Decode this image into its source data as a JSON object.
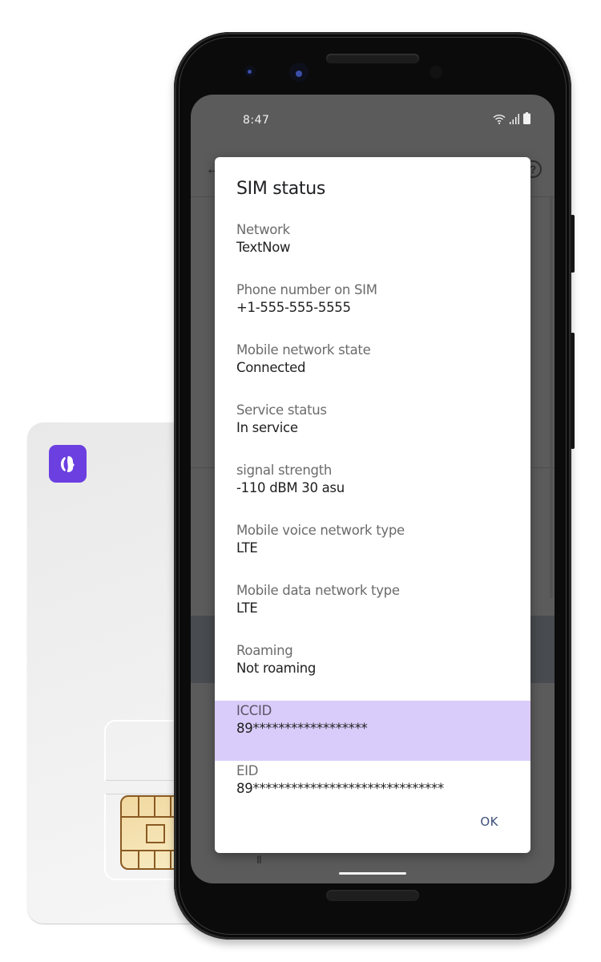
{
  "status_bar": {
    "time": "8:47",
    "icons": [
      "wifi-icon",
      "signal-icon",
      "battery-icon"
    ]
  },
  "background_screen": {
    "back_icon": "←",
    "help_icon": "?",
    "nav_pause_glyph": "II"
  },
  "dialog": {
    "title": "SIM status",
    "rows": [
      {
        "label": "Network",
        "value": "TextNow",
        "highlighted": false
      },
      {
        "label": "Phone number on SIM",
        "value": "+1-555-555-5555",
        "highlighted": false
      },
      {
        "label": "Mobile network state",
        "value": "Connected",
        "highlighted": false
      },
      {
        "label": "Service status",
        "value": "In service",
        "highlighted": false
      },
      {
        "label": "signal strength",
        "value": "-110 dBM 30 asu",
        "highlighted": false
      },
      {
        "label": "Mobile voice network type",
        "value": "LTE",
        "highlighted": false
      },
      {
        "label": "Mobile data network type",
        "value": "LTE",
        "highlighted": false
      },
      {
        "label": "Roaming",
        "value": "Not roaming",
        "highlighted": false
      },
      {
        "label": "ICCID",
        "value": "89******************",
        "highlighted": true
      },
      {
        "label": "EID",
        "value": "89******************************",
        "highlighted": false
      }
    ],
    "ok_label": "OK"
  },
  "colors": {
    "highlight": "#d9ccfa",
    "brand_purple": "#6b3fe0",
    "ok_text": "#3f4f7a"
  },
  "sim_card": {
    "logo_icon": "textnow-logo-icon"
  }
}
